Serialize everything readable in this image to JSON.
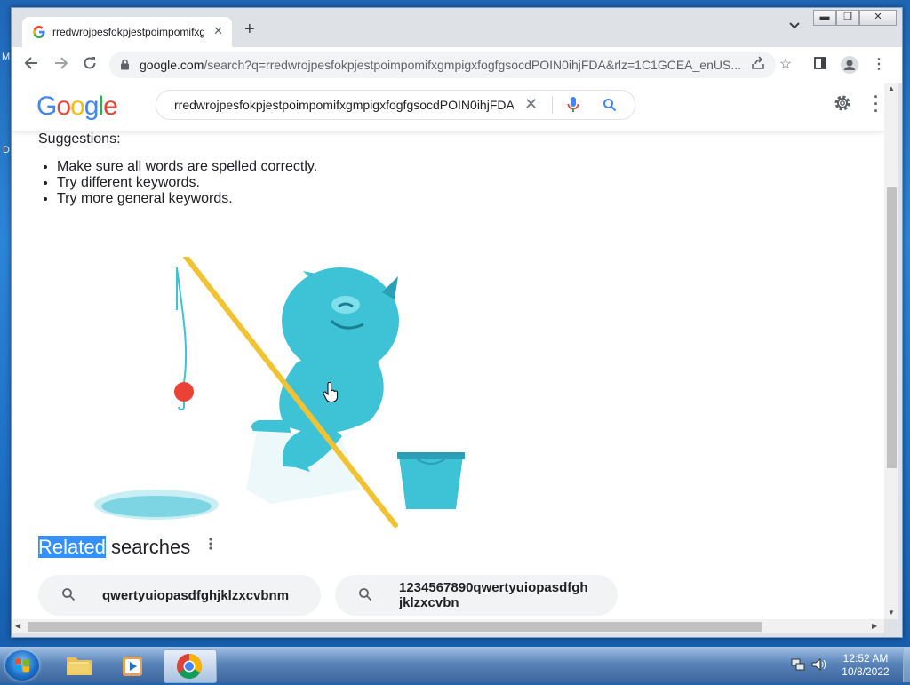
{
  "desktop": {
    "fragment_1": "M",
    "fragment_2": "D"
  },
  "browser": {
    "tab_title": "rredwrojpesfokpjestpoimpomifxgmpigxfogfgsocdPOIN0ihjFDA",
    "url_host": "google.com",
    "url_rest": "/search?q=rredwrojpesfokpjestpoimpomifxgmpigxfogfgsocdPOIN0ihjFDA&rlz=1C1GCEA_enUS..."
  },
  "google": {
    "search_query": "rredwrojpesfokpjestpoimpomifxgmpigxfogfgsocdPOIN0ihjFDA",
    "suggestions_heading": "Suggestions:",
    "suggestions": [
      "Make sure all words are spelled correctly.",
      "Try different keywords.",
      "Try more general keywords."
    ],
    "related_highlight": "Related",
    "related_rest": " searches",
    "related": [
      "qwertyuiopasdfghjklzxcvbnm",
      "1234567890qwertyuiopasdfgh",
      "jklzxcvbn"
    ]
  },
  "taskbar": {
    "time": "12:52 AM",
    "date": "10/8/2022"
  },
  "colors": {
    "google_blue": "#4285f4",
    "google_red": "#ea4335",
    "google_yellow": "#fbbc05",
    "google_green": "#34a853",
    "yeti": "#3ec2d6",
    "selection": "#3390ff"
  }
}
